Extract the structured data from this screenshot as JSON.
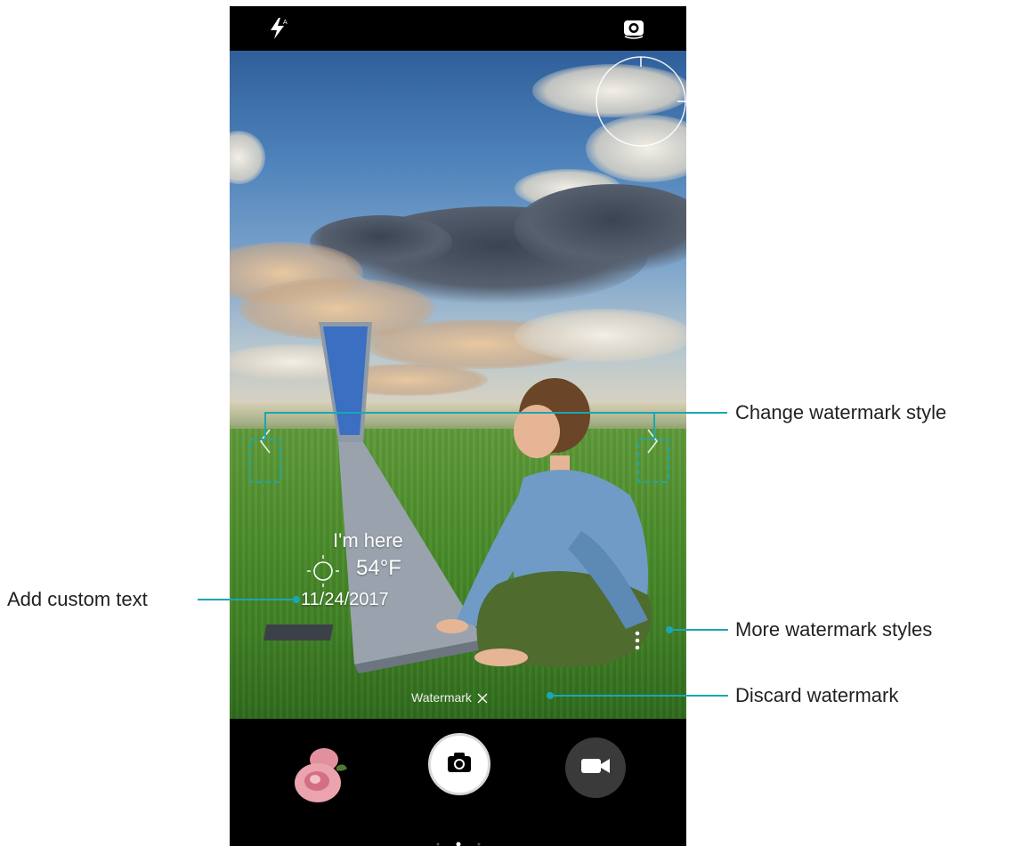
{
  "watermark": {
    "custom_text": "I'm here",
    "temperature": "54°F",
    "date": "11/24/2017",
    "discard_label": "Watermark",
    "discard_icon": "close-icon"
  },
  "callouts": {
    "change_style": "Change watermark style",
    "custom_text": "Add custom text",
    "more_styles": "More watermark styles",
    "discard": "Discard watermark"
  },
  "icons": {
    "flash": "flash-auto-icon",
    "switch_camera": "switch-camera-icon",
    "shutter": "camera-icon",
    "video": "video-camera-icon",
    "more": "more-vertical-icon",
    "weather": "sun-icon"
  },
  "colors": {
    "callout_line": "#1aa7b2",
    "shutter_ring": "#ffffff",
    "video_button": "#3a3a3a"
  }
}
